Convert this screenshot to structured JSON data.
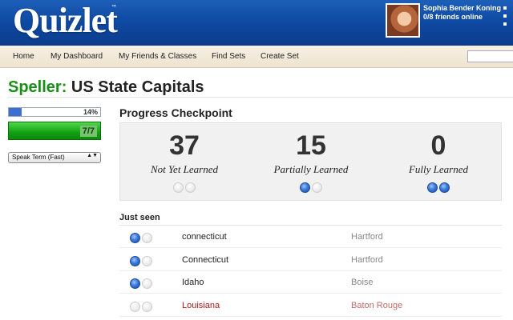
{
  "header": {
    "logo_text": "Quizlet",
    "trademark": "™",
    "user_name": "Sophia Bender Koning",
    "friends_online": "0/8 friends online"
  },
  "nav": {
    "items": [
      "Home",
      "My Dashboard",
      "My Friends & Classes",
      "Find Sets",
      "Create Set"
    ],
    "search_value": ""
  },
  "page": {
    "title_label": "Speller:",
    "title_text": "US State Capitals"
  },
  "sidebar": {
    "progress_percent_text": "14%",
    "progress_fraction": 0.14,
    "score_text": "7/7",
    "speak_option": "Speak Term (Fast)"
  },
  "checkpoint": {
    "title": "Progress Checkpoint",
    "stats": [
      {
        "value": "37",
        "label": "Not Yet Learned",
        "dots": [
          false,
          false
        ]
      },
      {
        "value": "15",
        "label": "Partially Learned",
        "dots": [
          true,
          false
        ]
      },
      {
        "value": "0",
        "label": "Fully Learned",
        "dots": [
          true,
          true
        ]
      }
    ]
  },
  "just_seen": {
    "title": "Just seen",
    "rows": [
      {
        "term": "connecticut",
        "definition": "Hartford",
        "dots": [
          true,
          false
        ],
        "error": false
      },
      {
        "term": "Connecticut",
        "definition": "Hartford",
        "dots": [
          true,
          false
        ],
        "error": false
      },
      {
        "term": "Idaho",
        "definition": "Boise",
        "dots": [
          true,
          false
        ],
        "error": false
      },
      {
        "term": "Louisiana",
        "definition": "Baton Rouge",
        "dots": [
          false,
          false
        ],
        "error": true
      }
    ]
  },
  "colors": {
    "brand_blue": "#0f4aa3",
    "title_green": "#1a8f17",
    "error_red": "#b01a1a",
    "dot_blue": "#3a79d8"
  }
}
